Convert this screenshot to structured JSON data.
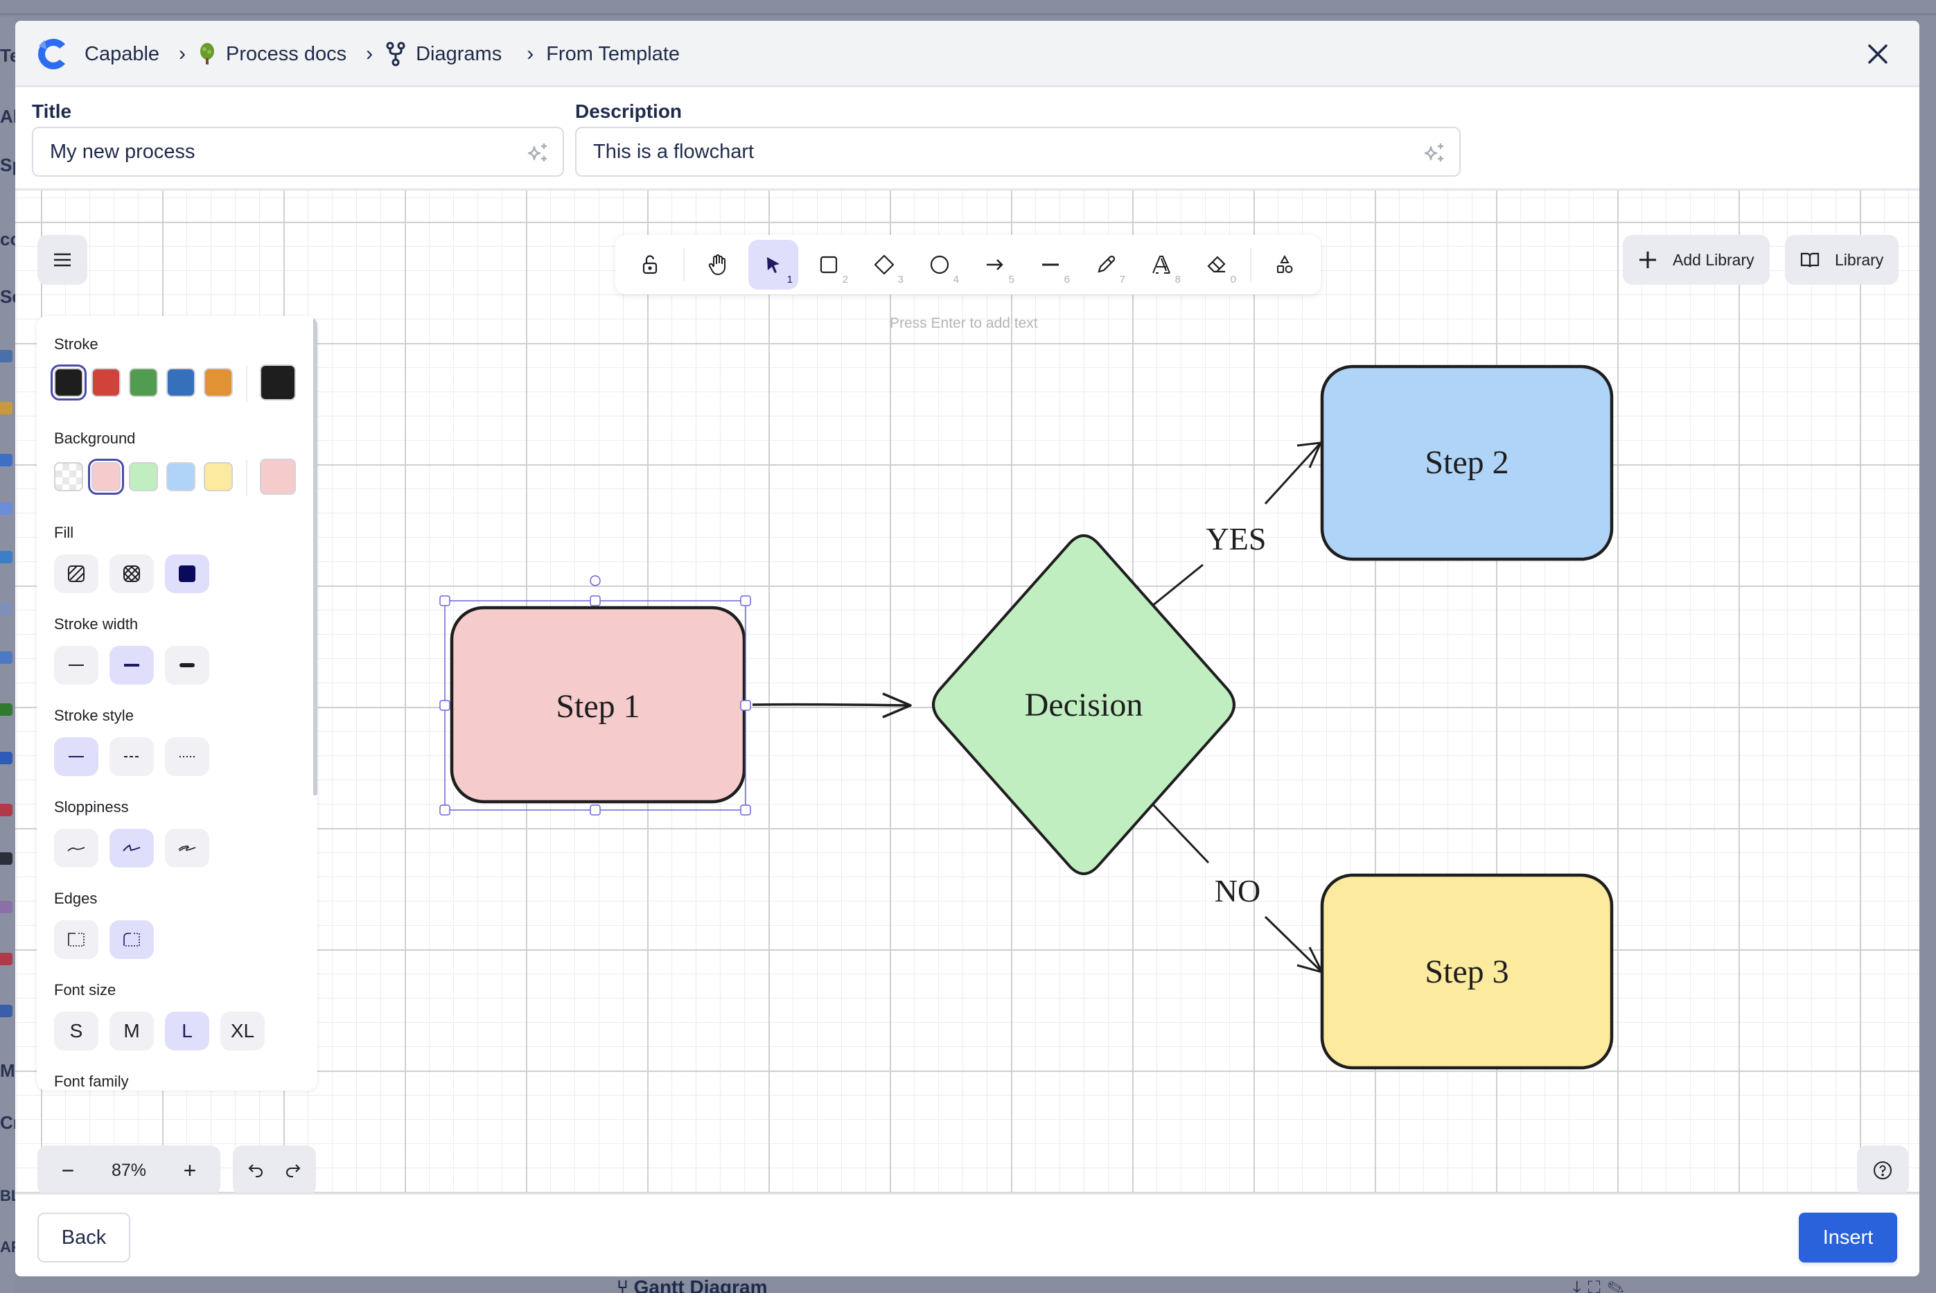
{
  "background": {
    "left_fragments": [
      "Te",
      "Al",
      "Sp",
      "co",
      "Se",
      "M",
      "Cr",
      "BL",
      "AF"
    ],
    "bottom_item": "Gantt Diagram"
  },
  "header": {
    "app_name": "Capable",
    "breadcrumbs": [
      {
        "label": "Capable",
        "icon": "capable-logo-icon"
      },
      {
        "label": "Process docs",
        "icon": "tree-emoji-icon"
      },
      {
        "label": "Diagrams",
        "icon": "git-fork-icon"
      },
      {
        "label": "From Template",
        "icon": ""
      }
    ],
    "close_icon": "close-icon"
  },
  "form": {
    "title_label": "Title",
    "title_value": "My new process",
    "description_label": "Description",
    "description_value": "This is a flowchart",
    "ai_icon": "sparkles-icon"
  },
  "toolbar": {
    "tools": [
      {
        "name": "lock",
        "icon": "lock-open-icon",
        "key": ""
      },
      {
        "name": "hand",
        "icon": "hand-icon",
        "key": ""
      },
      {
        "name": "selection",
        "icon": "pointer-icon",
        "key": "1",
        "active": true
      },
      {
        "name": "rectangle",
        "icon": "rectangle-icon",
        "key": "2"
      },
      {
        "name": "diamond",
        "icon": "diamond-icon",
        "key": "3"
      },
      {
        "name": "ellipse",
        "icon": "ellipse-icon",
        "key": "4"
      },
      {
        "name": "arrow",
        "icon": "arrow-icon",
        "key": "5"
      },
      {
        "name": "line",
        "icon": "line-icon",
        "key": "6"
      },
      {
        "name": "draw",
        "icon": "pencil-icon",
        "key": "7"
      },
      {
        "name": "text",
        "icon": "text-icon",
        "key": "8"
      },
      {
        "name": "eraser",
        "icon": "eraser-icon",
        "key": "0"
      },
      {
        "name": "more-shapes",
        "icon": "shapes-icon",
        "key": ""
      }
    ],
    "hint": "Press Enter to add text",
    "add_library_label": "Add Library",
    "library_label": "Library"
  },
  "properties": {
    "stroke_label": "Stroke",
    "stroke_colors": [
      "#1e1e1e",
      "#d0433b",
      "#529c4f",
      "#3670bb",
      "#e19235"
    ],
    "stroke_selected": "#1e1e1e",
    "background_label": "Background",
    "background_colors": [
      "transparent",
      "#f5cbcb",
      "#c0eec0",
      "#b0d4f7",
      "#fcea9e"
    ],
    "background_selected": "#f5cbcb",
    "fill_label": "Fill",
    "fill_options": [
      "hachure",
      "cross-hatch",
      "solid"
    ],
    "fill_selected": "solid",
    "stroke_width_label": "Stroke width",
    "stroke_width_options": [
      "thin",
      "bold",
      "extra-bold"
    ],
    "stroke_width_selected": "bold",
    "stroke_style_label": "Stroke style",
    "stroke_style_options": [
      "solid",
      "dashed",
      "dotted"
    ],
    "stroke_style_selected": "solid",
    "sloppiness_label": "Sloppiness",
    "sloppiness_options": [
      "architect",
      "artist",
      "cartoonist"
    ],
    "sloppiness_selected": "artist",
    "edges_label": "Edges",
    "edges_options": [
      "sharp",
      "round"
    ],
    "edges_selected": "round",
    "font_size_label": "Font size",
    "font_size_options": [
      "S",
      "M",
      "L",
      "XL"
    ],
    "font_size_selected": "L",
    "font_family_label": "Font family"
  },
  "footer_controls": {
    "zoom_out": "−",
    "zoom_level": "87%",
    "zoom_in": "+",
    "undo_icon": "undo-icon",
    "redo_icon": "redo-icon",
    "help_icon": "help-icon"
  },
  "diagram": {
    "nodes": [
      {
        "id": "step1",
        "label": "Step 1",
        "shape": "rectangle",
        "fill": "#f5cbcb",
        "selected": true
      },
      {
        "id": "decision",
        "label": "Decision",
        "shape": "diamond",
        "fill": "#c0eec0"
      },
      {
        "id": "step2",
        "label": "Step 2",
        "shape": "rectangle",
        "fill": "#b0d4f7"
      },
      {
        "id": "step3",
        "label": "Step 3",
        "shape": "rectangle",
        "fill": "#fcea9e"
      }
    ],
    "edges": [
      {
        "from": "step1",
        "to": "decision",
        "label": ""
      },
      {
        "from": "decision",
        "to": "step2",
        "label": "YES"
      },
      {
        "from": "decision",
        "to": "step3",
        "label": "NO"
      }
    ],
    "stroke_color": "#1e1e1e",
    "selection_color": "#6965db"
  },
  "footer": {
    "back_label": "Back",
    "insert_label": "Insert",
    "insert_color": "#2a62dc"
  }
}
